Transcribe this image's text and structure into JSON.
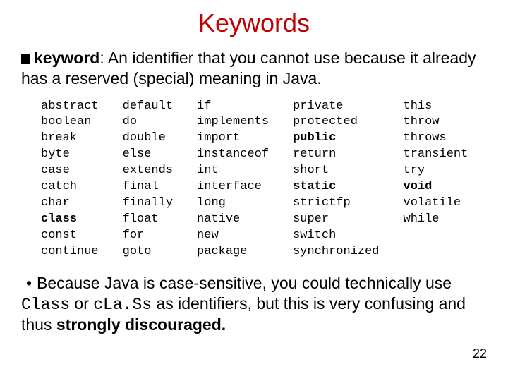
{
  "title": "Keywords",
  "def": {
    "term": "keyword",
    "rest": ": An identifier that you cannot use because it already has a reserved (special) meaning in Java."
  },
  "cols": {
    "c0": [
      "abstract",
      "boolean",
      "break",
      "byte",
      "case",
      "catch",
      "char",
      "class",
      "const",
      "continue"
    ],
    "c1": [
      "default",
      "do",
      "double",
      "else",
      "extends",
      "final",
      "finally",
      "float",
      "for",
      "goto"
    ],
    "c2": [
      "if",
      "implements",
      "import",
      "instanceof",
      "int",
      "interface",
      "long",
      "native",
      "new",
      "package"
    ],
    "c3": [
      "private",
      "protected",
      "public",
      "return",
      "short",
      "static",
      "strictfp",
      "super",
      "switch",
      "synchronized"
    ],
    "c4": [
      "this",
      "throw",
      "throws",
      "transient",
      "try",
      "void",
      "volatile",
      "while"
    ]
  },
  "bold_keywords": [
    "class",
    "public",
    "static",
    "void"
  ],
  "note": {
    "pre": "Because Java is case-sensitive, you could technically use ",
    "m0": "Class",
    "mid": " or ",
    "m1": "cLa.Ss",
    "post1": " as identifiers, but this is very confusing and thus ",
    "strong": "strongly discouraged.",
    "post2": ""
  },
  "page": "22"
}
